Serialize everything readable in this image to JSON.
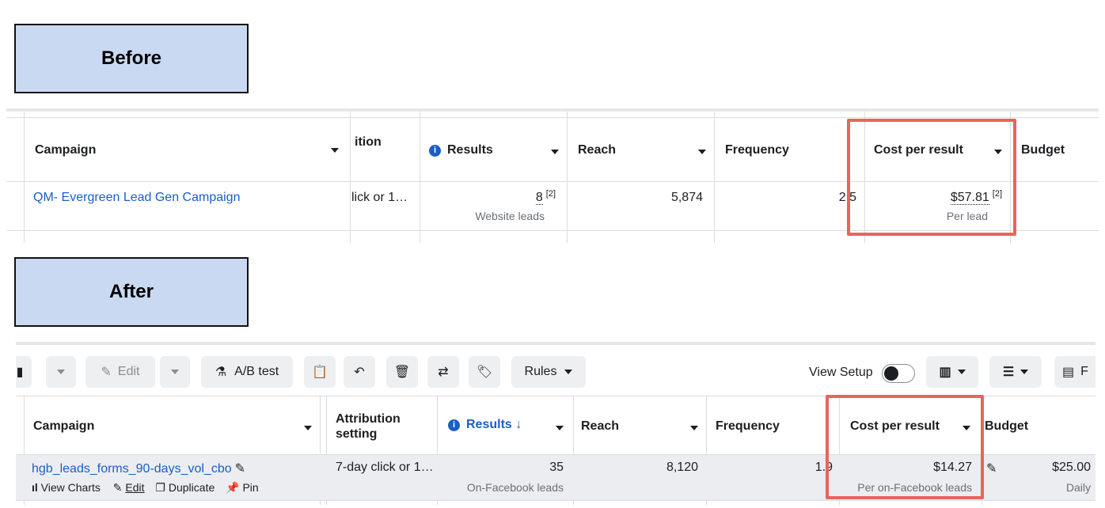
{
  "labels": {
    "before": "Before",
    "after": "After"
  },
  "before": {
    "headers": {
      "campaign": "Campaign",
      "attribution_partial": "ition",
      "results": "Results",
      "reach": "Reach",
      "frequency": "Frequency",
      "cost_per_result": "Cost per result",
      "budget": "Budget"
    },
    "row": {
      "campaign": "QM- Evergreen Lead Gen Campaign",
      "attribution": "lick or 1…",
      "results": "8",
      "results_ref": "[2]",
      "results_sub": "Website leads",
      "reach": "5,874",
      "frequency": "2.5",
      "cost": "$57.81",
      "cost_ref": "[2]",
      "cost_sub": "Per lead"
    }
  },
  "after": {
    "toolbar": {
      "edit": "Edit",
      "ab_test": "A/B test",
      "rules": "Rules",
      "view_setup": "View Setup",
      "partial_right": "F"
    },
    "headers": {
      "campaign": "Campaign",
      "attribution": "Attribution setting",
      "results": "Results ↓",
      "reach": "Reach",
      "frequency": "Frequency",
      "cost_per_result": "Cost per result",
      "budget": "Budget"
    },
    "row": {
      "campaign": "hgb_leads_forms_90-days_vol_cbo",
      "actions": {
        "view_charts": "View Charts",
        "edit": "Edit",
        "duplicate": "Duplicate",
        "pin": "Pin"
      },
      "attribution": "7-day click or 1…",
      "results": "35",
      "results_sub": "On-Facebook leads",
      "reach": "8,120",
      "frequency": "1.9",
      "cost": "$14.27",
      "cost_sub": "Per on-Facebook leads",
      "budget": "$25.00",
      "budget_sub": "Daily"
    }
  },
  "colors": {
    "label_bg": "#cad9f2",
    "highlight": "#e8655a",
    "link": "#1a5fc7"
  }
}
